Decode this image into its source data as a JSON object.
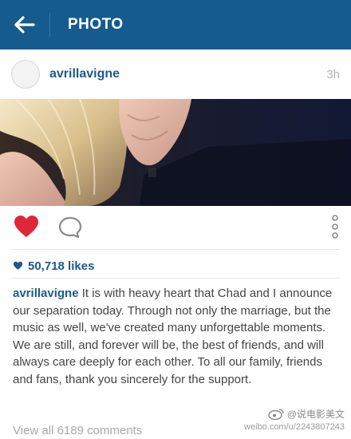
{
  "header": {
    "title": "PHOTO",
    "back_icon": "back-arrow-icon",
    "bg_color": "#155b8e"
  },
  "post": {
    "username": "avrillavigne",
    "timestamp": "3h",
    "liked": true,
    "like_color": "#e0273a",
    "likes": "50,718 likes",
    "caption_user": "avrillavigne",
    "caption_text": "It is with heavy heart that Chad and I announce our separation today. Through not only the marriage, but the music as well, we've created many unforgettable moments. We are still, and forever will be, the best of friends, and will always care deeply for each other. To all our family, friends and fans, thank you sincerely for the support.",
    "view_comments": "View all 6189 comments"
  },
  "icons": {
    "like": "heart-icon",
    "comment": "comment-bubble-icon",
    "more": "vertical-dots-icon",
    "likes": "small-heart-icon"
  },
  "watermark": {
    "handle": "@说电影美文",
    "url": "weibo.com/u/2243807243"
  }
}
